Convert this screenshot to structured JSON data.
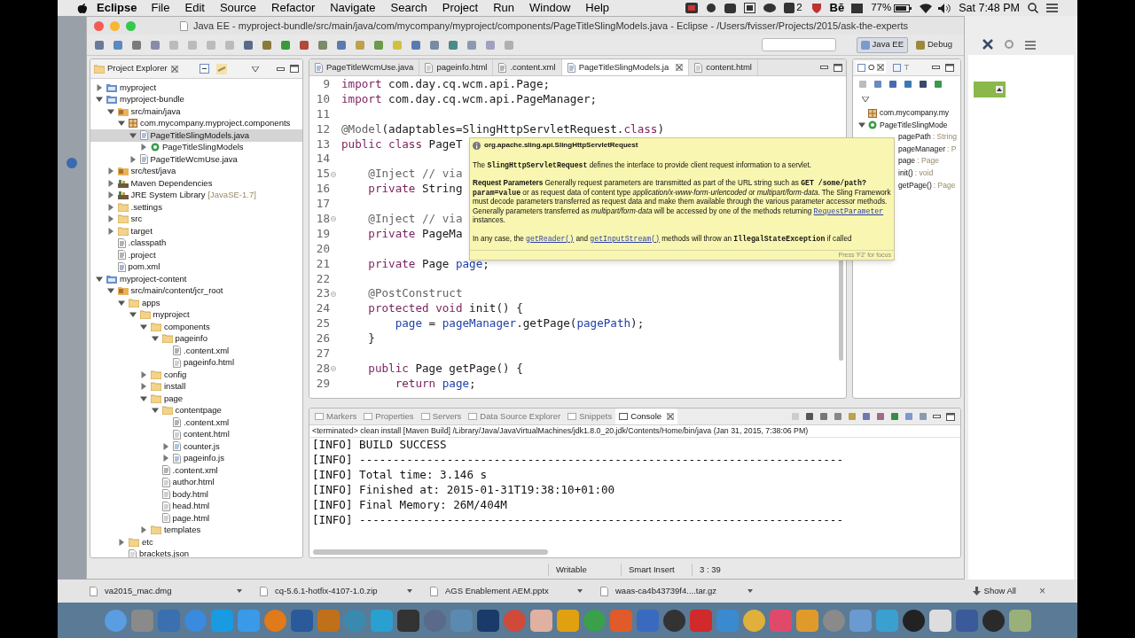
{
  "menubar": {
    "app": "Eclipse",
    "items": [
      "File",
      "Edit",
      "Source",
      "Refactor",
      "Navigate",
      "Search",
      "Project",
      "Run",
      "Window",
      "Help"
    ],
    "status": [
      {
        "kind": "badge",
        "text": "2"
      },
      {
        "kind": "logo",
        "text": "Bē"
      },
      {
        "kind": "battery",
        "text": "77%"
      },
      {
        "kind": "clock",
        "text": "Sat 7:48 PM"
      }
    ]
  },
  "window": {
    "title": "Java EE - myproject-bundle/src/main/java/com/mycompany/myproject/components/PageTitleSlingModels.java - Eclipse - /Users/fvisser/Projects/2015/ask-the-experts"
  },
  "perspectives": [
    {
      "label": "Java EE",
      "selected": true
    },
    {
      "label": "Debug",
      "selected": false
    }
  ],
  "project_explorer": {
    "title": "Project Explorer",
    "tree": [
      {
        "label": "myproject",
        "kind": "project",
        "expanded": false,
        "selected": false
      },
      {
        "label": "myproject-bundle",
        "kind": "project",
        "expanded": true,
        "selected": false,
        "children": [
          {
            "label": "src/main/java",
            "kind": "source",
            "expanded": true,
            "selected": false,
            "children": [
              {
                "label": "com.mycompany.myproject.components",
                "kind": "package",
                "expanded": true,
                "selected": false,
                "children": [
                  {
                    "label": "PageTitleSlingModels.java",
                    "kind": "java",
                    "expanded": true,
                    "selected": true,
                    "children": [
                      {
                        "label": "PageTitleSlingModels",
                        "kind": "class",
                        "expanded": false,
                        "selected": false
                      }
                    ]
                  },
                  {
                    "label": "PageTitleWcmUse.java",
                    "kind": "java",
                    "expanded": false,
                    "selected": false
                  }
                ]
              }
            ]
          },
          {
            "label": "src/test/java",
            "kind": "source",
            "expanded": false,
            "selected": false
          },
          {
            "label": "Maven Dependencies",
            "kind": "library",
            "expanded": false,
            "selected": false
          },
          {
            "label": "JRE System Library",
            "decoration": "[JavaSE-1.7]",
            "kind": "library",
            "expanded": false,
            "selected": false
          },
          {
            "label": ".settings",
            "kind": "folder",
            "expanded": false,
            "selected": false
          },
          {
            "label": "src",
            "kind": "folder",
            "expanded": false,
            "selected": false
          },
          {
            "label": "target",
            "kind": "folder",
            "expanded": false,
            "selected": false
          },
          {
            "label": ".classpath",
            "kind": "xml",
            "selected": false
          },
          {
            "label": ".project",
            "kind": "xml",
            "selected": false
          },
          {
            "label": "pom.xml",
            "kind": "pom",
            "selected": false
          }
        ]
      },
      {
        "label": "myproject-content",
        "kind": "project",
        "expanded": true,
        "selected": false,
        "children": [
          {
            "label": "src/main/content/jcr_root",
            "kind": "source",
            "expanded": true,
            "selected": false,
            "children": [
              {
                "label": "apps",
                "kind": "folder",
                "expanded": true,
                "selected": false,
                "children": [
                  {
                    "label": "myproject",
                    "kind": "folder",
                    "expanded": true,
                    "selected": false,
                    "children": [
                      {
                        "label": "components",
                        "kind": "folder",
                        "expanded": true,
                        "selected": false,
                        "children": [
                          {
                            "label": "pageinfo",
                            "kind": "folder",
                            "expanded": true,
                            "selected": false,
                            "children": [
                              {
                                "label": ".content.xml",
                                "kind": "xml",
                                "selected": false
                              },
                              {
                                "label": "pageinfo.html",
                                "kind": "html",
                                "selected": false
                              }
                            ]
                          }
                        ]
                      },
                      {
                        "label": "config",
                        "kind": "folder",
                        "expanded": false,
                        "selected": false
                      },
                      {
                        "label": "install",
                        "kind": "folder",
                        "expanded": false,
                        "selected": false
                      },
                      {
                        "label": "page",
                        "kind": "folder",
                        "expanded": true,
                        "selected": false,
                        "children": [
                          {
                            "label": "contentpage",
                            "kind": "folder",
                            "expanded": true,
                            "selected": false,
                            "children": [
                              {
                                "label": ".content.xml",
                                "kind": "xml",
                                "selected": false
                              },
                              {
                                "label": "content.html",
                                "kind": "html",
                                "selected": false
                              },
                              {
                                "label": "counter.js",
                                "kind": "js",
                                "expanded": false,
                                "selected": false
                              },
                              {
                                "label": "pageinfo.js",
                                "kind": "js",
                                "expanded": false,
                                "selected": false
                              }
                            ]
                          },
                          {
                            "label": ".content.xml",
                            "kind": "xml",
                            "selected": false
                          },
                          {
                            "label": "author.html",
                            "kind": "html",
                            "selected": false
                          },
                          {
                            "label": "body.html",
                            "kind": "html",
                            "selected": false
                          },
                          {
                            "label": "head.html",
                            "kind": "html",
                            "selected": false
                          },
                          {
                            "label": "page.html",
                            "kind": "html",
                            "selected": false
                          }
                        ]
                      },
                      {
                        "label": "templates",
                        "kind": "folder",
                        "expanded": false,
                        "selected": false
                      }
                    ]
                  }
                ]
              },
              {
                "label": "etc",
                "kind": "folder",
                "expanded": false,
                "selected": false
              },
              {
                "label": "brackets.json",
                "kind": "file",
                "selected": false
              }
            ]
          }
        ]
      }
    ]
  },
  "editor": {
    "tabs": [
      {
        "label": "PageTitleWcmUse.java",
        "kind": "java",
        "selected": false
      },
      {
        "label": "pageinfo.html",
        "kind": "html",
        "selected": false
      },
      {
        "label": ".content.xml",
        "kind": "xml",
        "selected": false
      },
      {
        "label": "PageTitleSlingModels.ja",
        "kind": "java",
        "selected": true
      },
      {
        "label": "content.html",
        "kind": "html",
        "selected": false
      }
    ],
    "lines": [
      {
        "number": "9",
        "segments": [
          {
            "kind": "keyword",
            "text": "import"
          },
          {
            "kind": "plain",
            "text": " com.day.cq.wcm.api.Page;"
          }
        ]
      },
      {
        "number": "10",
        "segments": [
          {
            "kind": "keyword",
            "text": "import"
          },
          {
            "kind": "plain",
            "text": " com.day.cq.wcm.api.PageManager;"
          }
        ]
      },
      {
        "number": "11"
      },
      {
        "number": "12",
        "segments": [
          {
            "kind": "annotation",
            "text": "@Model"
          },
          {
            "kind": "plain",
            "text": "(adaptables=SlingHttpServletRequest."
          },
          {
            "kind": "keyword",
            "text": "class"
          },
          {
            "kind": "plain",
            "text": ")"
          }
        ]
      },
      {
        "number": "13",
        "segments": [
          {
            "kind": "keyword",
            "text": "public class"
          },
          {
            "kind": "plain",
            "text": " PageT"
          }
        ]
      },
      {
        "number": "14"
      },
      {
        "number": "15",
        "fold": true,
        "segments": [
          {
            "kind": "annotation",
            "text": "    @Inject"
          },
          {
            "kind": "comment",
            "text": " // via"
          }
        ]
      },
      {
        "number": "16",
        "segments": [
          {
            "kind": "keyword",
            "text": "    private"
          },
          {
            "kind": "plain",
            "text": " String"
          }
        ]
      },
      {
        "number": "17"
      },
      {
        "number": "18",
        "fold": true,
        "segments": [
          {
            "kind": "annotation",
            "text": "    @Inject"
          },
          {
            "kind": "comment",
            "text": " // via"
          }
        ]
      },
      {
        "number": "19",
        "segments": [
          {
            "kind": "keyword",
            "text": "    private"
          },
          {
            "kind": "plain",
            "text": " PageMa"
          }
        ]
      },
      {
        "number": "20"
      },
      {
        "number": "21",
        "segments": [
          {
            "kind": "keyword",
            "text": "    private"
          },
          {
            "kind": "plain",
            "text": " Page "
          },
          {
            "kind": "field",
            "text": "page"
          },
          {
            "kind": "plain",
            "text": ";"
          }
        ]
      },
      {
        "number": "22"
      },
      {
        "number": "23",
        "fold": true,
        "segments": [
          {
            "kind": "annotation",
            "text": "    @PostConstruct"
          }
        ]
      },
      {
        "number": "24",
        "segments": [
          {
            "kind": "keyword",
            "text": "    protected void"
          },
          {
            "kind": "plain",
            "text": " init() {"
          }
        ]
      },
      {
        "number": "25",
        "segments": [
          {
            "kind": "field",
            "text": "        page"
          },
          {
            "kind": "plain",
            "text": " = "
          },
          {
            "kind": "field",
            "text": "pageManager"
          },
          {
            "kind": "plain",
            "text": ".getPage("
          },
          {
            "kind": "field",
            "text": "pagePath"
          },
          {
            "kind": "plain",
            "text": ");"
          }
        ]
      },
      {
        "number": "26",
        "segments": [
          {
            "kind": "plain",
            "text": "    }"
          }
        ]
      },
      {
        "number": "27"
      },
      {
        "number": "28",
        "fold": true,
        "segments": [
          {
            "kind": "keyword",
            "text": "    public"
          },
          {
            "kind": "plain",
            "text": " Page getPage() {"
          }
        ]
      },
      {
        "number": "29",
        "segments": [
          {
            "kind": "keyword",
            "text": "        return"
          },
          {
            "kind": "field",
            "text": " page"
          },
          {
            "kind": "plain",
            "text": ";"
          }
        ]
      }
    ]
  },
  "tooltip": {
    "title": "org.apache.sling.api.SlingHttpServletRequest",
    "paragraphs": [
      [
        {
          "kind": "text",
          "text": "The "
        },
        {
          "kind": "code",
          "text": "SlingHttpServletRequest"
        },
        {
          "kind": "text",
          "text": " defines the interface to provide client request information to a servlet."
        }
      ],
      [
        {
          "kind": "bold",
          "text": "Request Parameters"
        },
        {
          "kind": "text",
          "text": " Generally request parameters are transmitted as part of the URL string such as "
        },
        {
          "kind": "code",
          "text": "GET /some/path?param=value"
        },
        {
          "kind": "text",
          "text": " or as request data of content type "
        },
        {
          "kind": "italic",
          "text": "application/x-www-form-urlencoded"
        },
        {
          "kind": "text",
          "text": " or "
        },
        {
          "kind": "italic",
          "text": "multipart/form-data"
        },
        {
          "kind": "text",
          "text": ". The Sling Framework must decode parameters transferred as request data and make them available through the various parameter accessor methods. Generally parameters transferred as "
        },
        {
          "kind": "italic",
          "text": "multipart/form-data"
        },
        {
          "kind": "text",
          "text": " will be accessed by one of the methods returning "
        },
        {
          "kind": "link",
          "text": "RequestParameter"
        },
        {
          "kind": "text",
          "text": " instances."
        }
      ],
      [
        {
          "kind": "text",
          "text": "In any case, the "
        },
        {
          "kind": "link",
          "text": "getReader()"
        },
        {
          "kind": "text",
          "text": " and "
        },
        {
          "kind": "link",
          "text": "getInputStream()"
        },
        {
          "kind": "text",
          "text": " methods will throw an "
        },
        {
          "kind": "code",
          "text": "IllegalStateException"
        },
        {
          "kind": "text",
          "text": " if called"
        }
      ]
    ],
    "footer": "Press 'F2' for focus"
  },
  "outline": {
    "tabs": [
      {
        "label": "O",
        "selected": true
      },
      {
        "label": "T",
        "selected": false
      }
    ],
    "items": [
      {
        "name": "com.mycompany.my",
        "kind": "package",
        "selected": false
      },
      {
        "name": "PageTitleSlingMode",
        "kind": "class",
        "expanded": true,
        "selected": false,
        "children": [
          {
            "name": "pagePath",
            "type": ": String",
            "selected": false
          },
          {
            "name": "pageManager",
            "type": ": P",
            "selected": false
          },
          {
            "name": "page",
            "type": ": Page",
            "selected": false
          },
          {
            "name": "init()",
            "type": ": void",
            "selected": false
          },
          {
            "name": "getPage()",
            "type": ": Page",
            "selected": false
          }
        ]
      }
    ]
  },
  "console": {
    "tabs": [
      {
        "label": "Markers",
        "selected": false
      },
      {
        "label": "Properties",
        "selected": false
      },
      {
        "label": "Servers",
        "selected": false
      },
      {
        "label": "Data Source Explorer",
        "selected": false
      },
      {
        "label": "Snippets",
        "selected": false
      },
      {
        "label": "Console",
        "selected": true
      }
    ],
    "header": "<terminated> clean install [Maven Build] /Library/Java/JavaVirtualMachines/jdk1.8.0_20.jdk/Contents/Home/bin/java (Jan 31, 2015, 7:38:06 PM)",
    "lines": [
      "[INFO] BUILD SUCCESS",
      "[INFO] ------------------------------------------------------------------------",
      "[INFO] Total time: 3.146 s",
      "[INFO] Finished at: 2015-01-31T19:38:10+01:00",
      "[INFO] Final Memory: 26M/404M",
      "[INFO] ------------------------------------------------------------------------"
    ]
  },
  "status_bar": [
    "Writable",
    "Smart Insert",
    "3 : 39"
  ],
  "downloads": {
    "items": [
      "va2015_mac.dmg",
      "cq-5.6.1-hotfix-4107-1.0.zip",
      "AGS Enablement AEM.pptx",
      "waas-ca4b43739f4....tar.gz"
    ],
    "show_all": "Show All",
    "close": "×"
  }
}
